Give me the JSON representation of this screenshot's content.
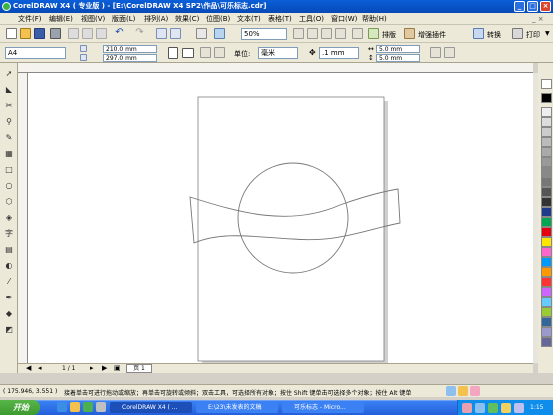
{
  "window": {
    "title": "CorelDRAW X4 ( 专业版 ) - [E:\\CorelDRAW X4 SP2\\作品\\可乐标志.cdr]",
    "min": "_",
    "max": "□",
    "close": "×"
  },
  "menu": [
    "文件(F)",
    "编辑(E)",
    "视图(V)",
    "版面(L)",
    "排列(A)",
    "效果(C)",
    "位图(B)",
    "文本(T)",
    "表格(T)",
    "工具(O)",
    "窗口(W)",
    "帮助(H)"
  ],
  "standard_bar": {
    "zoom": "50%",
    "buttons": {
      "typeset": "排版",
      "plugin": "增强插件",
      "convert": "转换",
      "print": "打印",
      "dropdown": "▼"
    }
  },
  "property_bar": {
    "paper": "A4",
    "width": "210.0 mm",
    "height": "297.0 mm",
    "units_label": "单位:",
    "units": "毫米",
    "nudge": ".1 mm",
    "dup_x": "5.0 mm",
    "dup_y": "5.0 mm"
  },
  "page_nav": {
    "counter": "1 / 1",
    "page_tab": "页 1"
  },
  "status": {
    "coords": "( 175.946, 3.551 )",
    "hint": "接着单击可进行拖动或缩放；再单击可旋转或倾斜；双击工具，可选择所有对象；按住 Shift 键单击可选择多个对象；按住 Alt 键单"
  },
  "taskbar": {
    "start": "开始",
    "tasks": [
      "CorelDRAW X4 ( ...",
      "E:\\23\\未发表的文稿",
      "可乐标志 - Micro..."
    ],
    "clock": "1:15"
  },
  "colors": {
    "accent": "#0a5fd8",
    "chrome": "#ece9d8",
    "task_active": "#1c4fb8",
    "task_inactive": "#3c81f3"
  },
  "icons": [
    "new-icon",
    "open-icon",
    "save-icon",
    "print-icon",
    "cut-icon",
    "copy-icon",
    "paste-icon",
    "undo-icon",
    "redo-icon",
    "import-icon",
    "export-icon"
  ]
}
